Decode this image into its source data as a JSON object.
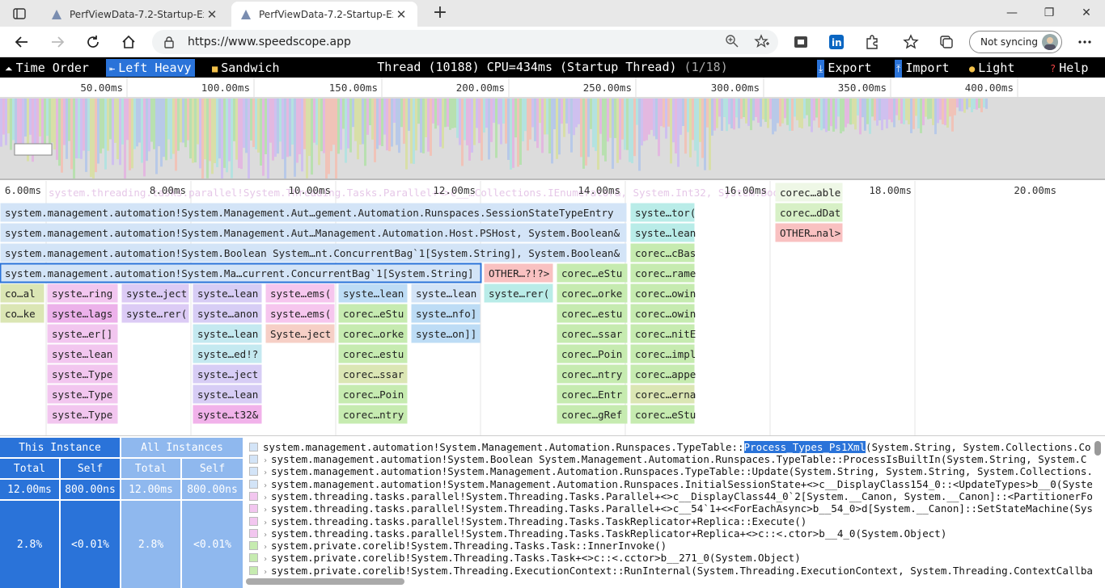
{
  "browser": {
    "tabs": [
      {
        "title": "PerfViewData-7.2-Startup-Exit-Js",
        "active": false
      },
      {
        "title": "PerfViewData-7.2-Startup-Exit-Js",
        "active": true
      }
    ],
    "url": "https://www.speedscope.app",
    "sync_label": "Not syncing"
  },
  "toolbar": {
    "time_order": "Time Order",
    "left_heavy": "Left Heavy",
    "sandwich": "Sandwich",
    "title": "Thread (10188) CPU=434ms (Startup Thread)",
    "counter": "(1/18)",
    "export": "Export",
    "import": "Import",
    "light": "Light",
    "help": "Help"
  },
  "minimap": {
    "ticks": [
      "50.00ms",
      "100.00ms",
      "150.00ms",
      "200.00ms",
      "250.00ms",
      "300.00ms",
      "350.00ms",
      "400.00ms"
    ]
  },
  "flame": {
    "ticks": [
      "6.00ms",
      "8.00ms",
      "10.00ms",
      "12.00ms",
      "14.00ms",
      "16.00ms",
      "18.00ms",
      "20.00ms"
    ],
    "ghost_label": "system.threading.tasks.parallel!System.Threading.Tasks.Parallel+<>c__…Collections.IEnumerator&, System.Int32, System.Boolean&",
    "frames": [
      {
        "row": 0,
        "label": "corec…able",
        "color": "#eef7e6"
      },
      {
        "row": 1,
        "label": "system.management.automation!System.Management.Aut…gement.Automation.Runspaces.SessionStateTypeEntry",
        "color": "#d3e4f7"
      },
      {
        "row": 1,
        "label": "syste…tor(",
        "color": "#b9ece8"
      },
      {
        "row": 1,
        "label": "corec…dDat",
        "color": "#d7f0c6"
      },
      {
        "row": 2,
        "label": "system.management.automation!System.Management.Aut…Management.Automation.Host.PSHost, System.Boolean&",
        "color": "#d3e4f7"
      },
      {
        "row": 2,
        "label": "syste…lean",
        "color": "#b9ece8"
      },
      {
        "row": 2,
        "label": "OTHER…nal>",
        "color": "#f9c1c1"
      },
      {
        "row": 3,
        "label": "system.management.automation!System.Boolean System…nt.ConcurrentBag`1[System.String], System.Boolean&",
        "color": "#d3e4f7"
      },
      {
        "row": 3,
        "label": "corec…cBas",
        "color": "#c6ebb0"
      },
      {
        "row": 4,
        "label": "system.management.automation!System.Ma…current.ConcurrentBag`1[System.String]",
        "color": "#d3e4f7"
      },
      {
        "row": 4,
        "label": "OTHER…?!?>",
        "color": "#f9c1c1"
      },
      {
        "row": 4,
        "label": "corec…eStu",
        "color": "#c6ebb0"
      },
      {
        "row": 4,
        "label": "corec…rame",
        "color": "#c6ebb0"
      },
      {
        "row": 5,
        "label": "co…al",
        "color": "#dbe6b4"
      },
      {
        "row": 5,
        "label": "syste…ring",
        "color": "#f2c6ef"
      },
      {
        "row": 5,
        "label": "syste…ject",
        "color": "#dccbf5"
      },
      {
        "row": 5,
        "label": "syste…lean",
        "color": "#d7cdf5"
      },
      {
        "row": 5,
        "label": "syste…ems(",
        "color": "#f6c6ee"
      },
      {
        "row": 5,
        "label": "syste…lean",
        "color": "#bddcf5"
      },
      {
        "row": 5,
        "label": "syste…lean",
        "color": "#d3e4f7"
      },
      {
        "row": 5,
        "label": "syste…rer(",
        "color": "#b9ece8"
      },
      {
        "row": 5,
        "label": "corec…orke",
        "color": "#c6ebb0"
      },
      {
        "row": 5,
        "label": "corec…owin",
        "color": "#c6ebb0"
      },
      {
        "row": 6,
        "label": "co…ke",
        "color": "#dbe6b4"
      },
      {
        "row": 6,
        "label": "syste…lags",
        "color": "#ecb1ea"
      },
      {
        "row": 6,
        "label": "syste…rer(",
        "color": "#dccbf5"
      },
      {
        "row": 6,
        "label": "syste…anon",
        "color": "#d7cdf5"
      },
      {
        "row": 6,
        "label": "syste…ems(",
        "color": "#f6c6ee"
      },
      {
        "row": 6,
        "label": "corec…eStu",
        "color": "#c6ebb0"
      },
      {
        "row": 6,
        "label": "syste…nfo]",
        "color": "#bddcf5"
      },
      {
        "row": 6,
        "label": "corec…estu",
        "color": "#c6ebb0"
      },
      {
        "row": 6,
        "label": "corec…owin",
        "color": "#c6ebb0"
      },
      {
        "row": 7,
        "label": "syste…er[]",
        "color": "#f2c6ef"
      },
      {
        "row": 7,
        "label": "syste…lean",
        "color": "#c4e9f0"
      },
      {
        "row": 7,
        "label": "Syste…ject",
        "color": "#f6cfc6"
      },
      {
        "row": 7,
        "label": "corec…orke",
        "color": "#c6ebb0"
      },
      {
        "row": 7,
        "label": "syste…on]]",
        "color": "#bddcf5"
      },
      {
        "row": 7,
        "label": "corec…ssar",
        "color": "#c6ebb0"
      },
      {
        "row": 7,
        "label": "corec…nitE",
        "color": "#c6ebb0"
      },
      {
        "row": 8,
        "label": "syste…lean",
        "color": "#f2c6ef"
      },
      {
        "row": 8,
        "label": "syste…ed!?",
        "color": "#c4e9f0"
      },
      {
        "row": 8,
        "label": "corec…estu",
        "color": "#c6ebb0"
      },
      {
        "row": 8,
        "label": "corec…Poin",
        "color": "#c6ebb0"
      },
      {
        "row": 8,
        "label": "corec…impl",
        "color": "#c6ebb0"
      },
      {
        "row": 9,
        "label": "syste…Type",
        "color": "#f2c6ef"
      },
      {
        "row": 9,
        "label": "syste…ject",
        "color": "#d7cdf5"
      },
      {
        "row": 9,
        "label": "corec…ssar",
        "color": "#dbe6b4"
      },
      {
        "row": 9,
        "label": "corec…ntry",
        "color": "#c6ebb0"
      },
      {
        "row": 9,
        "label": "corec…appe",
        "color": "#c6ebb0"
      },
      {
        "row": 10,
        "label": "syste…Type",
        "color": "#f2c6ef"
      },
      {
        "row": 10,
        "label": "syste…lean",
        "color": "#d7cdf5"
      },
      {
        "row": 10,
        "label": "corec…Poin",
        "color": "#c6ebb0"
      },
      {
        "row": 10,
        "label": "corec…Entr",
        "color": "#c6ebb0"
      },
      {
        "row": 10,
        "label": "corec…erna",
        "color": "#dbe6b4"
      },
      {
        "row": 11,
        "label": "syste…Type",
        "color": "#f2c6ef"
      },
      {
        "row": 11,
        "label": "syste…t32&",
        "color": "#f1b2ea"
      },
      {
        "row": 11,
        "label": "corec…ntry",
        "color": "#c6ebb0"
      },
      {
        "row": 11,
        "label": "corec…gRef",
        "color": "#c6ebb0"
      },
      {
        "row": 11,
        "label": "corec…eStu",
        "color": "#c6ebb0"
      }
    ]
  },
  "stats": {
    "this_instance": "This Instance",
    "all_instances": "All Instances",
    "total": "Total",
    "self": "Self",
    "this_total": "12.00ms",
    "this_self": "800.00ns",
    "all_total": "12.00ms",
    "all_self": "800.00ns",
    "this_total_pct": "2.8%",
    "this_self_pct": "<0.01%",
    "all_total_pct": "2.8%",
    "all_self_pct": "<0.01%"
  },
  "stack": {
    "first": {
      "before": "system.management.automation!System.Management.Automation.Runspaces.TypeTable::",
      "highlight": "Process_Types_Ps1Xml",
      "after": "(System.String, System.Collections.Cor"
    },
    "frames": [
      {
        "text": "system.management.automation!System.Boolean System.Management.Automation.Runspaces.TypeTable::ProcessIsBuiltIn(System.String, System.C",
        "color": "#d3e4f7"
      },
      {
        "text": "system.management.automation!System.Management.Automation.Runspaces.TypeTable::Update(System.String, System.String, System.Collections.",
        "color": "#d3e4f7"
      },
      {
        "text": "system.management.automation!System.Management.Automation.Runspaces.InitialSessionState+<>c__DisplayClass154_0::<UpdateTypes>b__0(Syste",
        "color": "#d3e4f7"
      },
      {
        "text": "system.threading.tasks.parallel!System.Threading.Tasks.Parallel+<>c__DisplayClass44_0`2[System.__Canon, System.__Canon]::<PartitionerFo",
        "color": "#f2c6ef"
      },
      {
        "text": "system.threading.tasks.parallel!System.Threading.Tasks.Parallel+<>c__54`1+<<ForEachAsync>b__54_0>d[System.__Canon]::SetStateMachine(Sys",
        "color": "#f2c6ef"
      },
      {
        "text": "system.threading.tasks.parallel!System.Threading.Tasks.TaskReplicator+Replica::Execute()",
        "color": "#f2c6ef"
      },
      {
        "text": "system.threading.tasks.parallel!System.Threading.Tasks.TaskReplicator+Replica+<>c::<.ctor>b__4_0(System.Object)",
        "color": "#f2c6ef"
      },
      {
        "text": "system.private.corelib!System.Threading.Tasks.Task::InnerInvoke()",
        "color": "#c6ebb0"
      },
      {
        "text": "system.private.corelib!System.Threading.Tasks.Task+<>c::<.cctor>b__271_0(System.Object)",
        "color": "#c6ebb0"
      },
      {
        "text": "system.private.corelib!System.Threading.ExecutionContext::RunInternal(System.Threading.ExecutionContext, System.Threading.ContextCallba",
        "color": "#c6ebb0"
      }
    ]
  }
}
